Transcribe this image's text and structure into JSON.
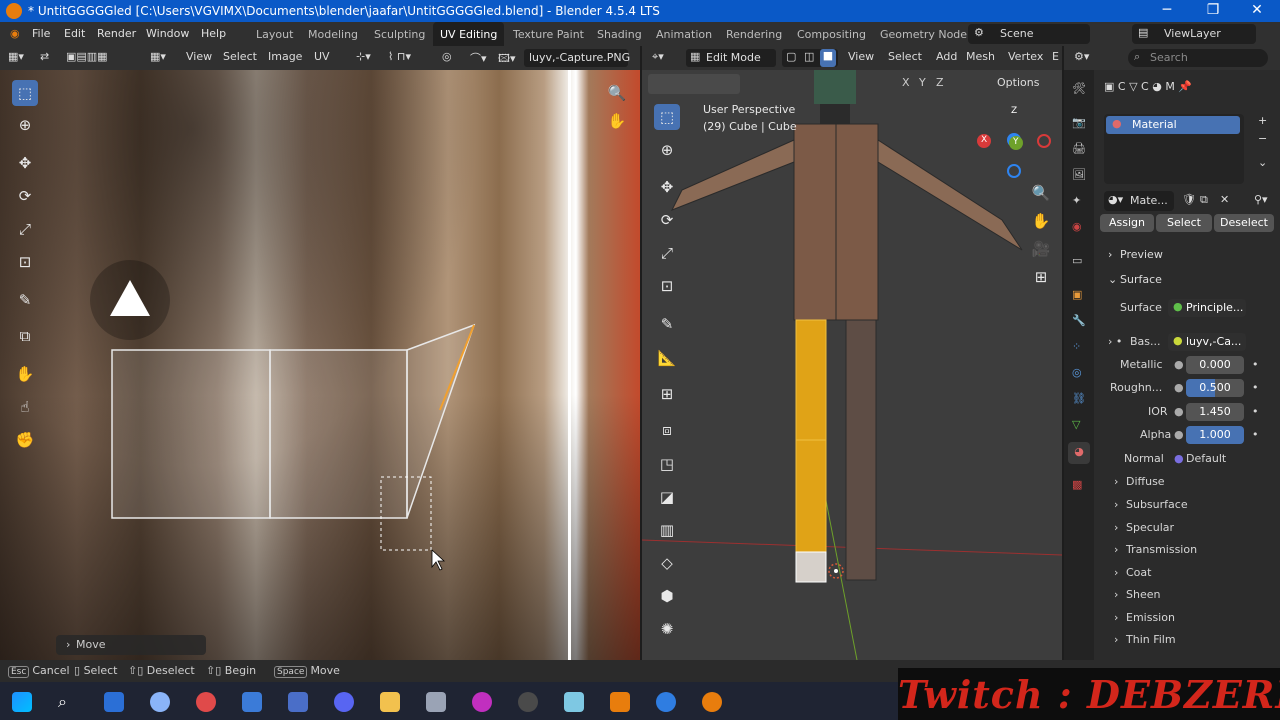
{
  "title_bar": {
    "text": "* UntitGGGGGled [C:\\Users\\VGVIMX\\Documents\\blender\\jaafar\\UntitGGGGGled.blend] - Blender 4.5.4 LTS",
    "minimize": "─",
    "maximize": "❐",
    "close": "✕"
  },
  "menu": {
    "file": "File",
    "edit": "Edit",
    "render": "Render",
    "window": "Window",
    "help": "Help"
  },
  "workspaces": [
    "Layout",
    "Modeling",
    "Sculpting",
    "UV Editing",
    "Texture Paint",
    "Shading",
    "Animation",
    "Rendering",
    "Compositing",
    "Geometry Node"
  ],
  "active_workspace": "UV Editing",
  "scene": {
    "label": "Scene",
    "view_layer": "ViewLayer"
  },
  "uv_header": {
    "view": "View",
    "select": "Select",
    "image": "Image",
    "uv": "UV",
    "image_name": "luyv,-Capture.PNG"
  },
  "view3d_header": {
    "mode": "Edit Mode",
    "view": "View",
    "select": "Select",
    "add": "Add",
    "mesh": "Mesh",
    "vertex": "Vertex",
    "edge": "E",
    "options": "Options",
    "axes": [
      "X",
      "Y",
      "Z"
    ]
  },
  "viewport_info": {
    "line1": "User Perspective",
    "line2": "(29) Cube | Cube"
  },
  "gizmo": {
    "z": "Z",
    "y": "Y",
    "x": "X"
  },
  "operator_panel": {
    "label": "Move"
  },
  "props": {
    "breadcrumbs": [
      "C",
      "C",
      "M"
    ],
    "search_placeholder": "Search",
    "material_slot": "Material",
    "material_name": "Mate...",
    "assign": "Assign",
    "select": "Select",
    "deselect": "Deselect",
    "preview": "Preview",
    "surface_header": "Surface",
    "surface_label": "Surface",
    "surface_value": "Principle...",
    "base_label": "Bas...",
    "base_value": "luyv,-Ca...",
    "metallic_label": "Metallic",
    "metallic_value": "0.000",
    "roughness_label": "Roughn...",
    "roughness_value": "0.500",
    "ior_label": "IOR",
    "ior_value": "1.450",
    "alpha_label": "Alpha",
    "alpha_value": "1.000",
    "normal_label": "Normal",
    "normal_value": "Default",
    "sections": [
      "Diffuse",
      "Subsurface",
      "Specular",
      "Transmission",
      "Coat",
      "Sheen",
      "Emission",
      "Thin Film"
    ]
  },
  "status": {
    "cancel_key": "Esc",
    "cancel": "Cancel",
    "select": "Select",
    "deselect": "Deselect",
    "begin": "Begin",
    "move_key": "Space",
    "move": "Move"
  },
  "twitch": "Twitch : DEBZERK",
  "colors": {
    "accent": "#4772b3",
    "title_bar": "#0a59c7",
    "uv_edge": "#e0e0e0",
    "selected_face": "#e8a317",
    "twitch_red": "#d3261b"
  }
}
